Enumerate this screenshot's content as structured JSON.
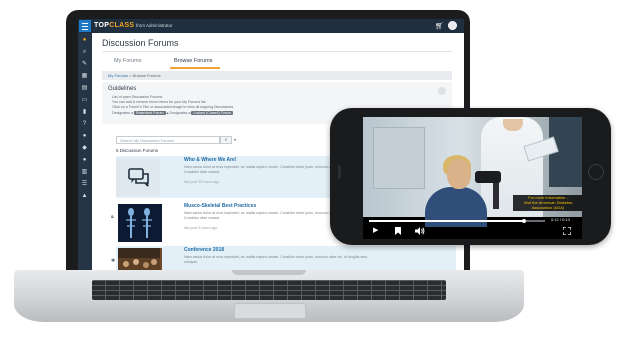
{
  "app": {
    "logo_part1": "TOP",
    "logo_part2": "CLASS",
    "role": "from Administrator"
  },
  "page": {
    "title": "Discussion Forums",
    "tabs": [
      {
        "label": "My Forums",
        "active": false
      },
      {
        "label": "Browse Forums",
        "active": true
      }
    ],
    "breadcrumb": {
      "home": "My Forums",
      "separator": " > ",
      "current": "Browse Forums"
    }
  },
  "guidelines": {
    "title": "Guidelines",
    "lines": [
      "List of open Discussion Forums.",
      "You can add & remove forum items for your My Forums list.",
      "Click on a Forum's Title or associated image to view all ongoing Discussions."
    ],
    "legend_prefix": "Designates a",
    "legend_pill1": "Restricted Forum",
    "legend_middle": "Designates a",
    "legend_pill2": "Locked (Closed) Forum"
  },
  "search": {
    "placeholder": "Search My Discussion Forums",
    "count_label": "5 Discussion Forums"
  },
  "forums": [
    {
      "title": "Who & Where We Are!",
      "desc": "Nam varius dolor at eros imperdiet, ac mattis sapien ornare. Curabitur tortor justo, rhoncus vitae vel, ut fringilla sem. Curabitur vitae massa.",
      "time": "last post 20 hours ago",
      "icon": "chat-bubbles-icon"
    },
    {
      "title": "Musco-Skeletal Best Practices",
      "desc": "Nam varius dolor at eros imperdiet, ac mattis sapien ornare. Curabitur tortor justo, rhoncus vitae vel, ut fringilla sem. Curabitur vitae massa.",
      "time": "last post 3 hours ago",
      "icon": "lock-icon"
    },
    {
      "title": "Conference 2018",
      "desc": "Nam varius dolor at eros imperdiet, ac mattis sapien ornare. Curabitur tortor justo, rhoncus vitae vel, ut fringilla sem, volutpat.",
      "time": "",
      "icon": "restricted-icon"
    }
  ],
  "video": {
    "caption_lines": [
      "For more information -",
      "Visit the American Diabetes",
      "Association (ADA)"
    ],
    "time": "0:12 / 0:13",
    "progress": 0.88
  }
}
